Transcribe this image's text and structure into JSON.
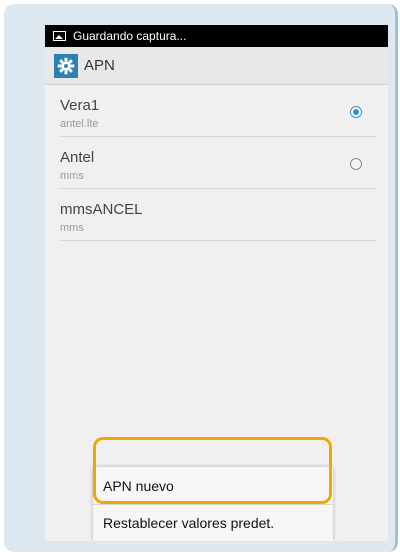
{
  "status_bar": {
    "text": "Guardando captura...",
    "icon": "image-icon"
  },
  "action_bar": {
    "title": "APN",
    "icon": "settings-gear-icon",
    "icon_color": "#2e7fb5"
  },
  "apn_list": [
    {
      "name": "Vera1",
      "type": "antel.lte",
      "selected": true
    },
    {
      "name": "Antel",
      "type": "mms",
      "selected": false
    },
    {
      "name": "mmsANCEL",
      "type": "mms",
      "selected": null
    }
  ],
  "menu": {
    "items": [
      {
        "label": "APN nuevo"
      },
      {
        "label": "Restablecer valores predet."
      }
    ]
  },
  "highlight_color": "#f0a800",
  "radio_checked_color": "#2b8fe0"
}
